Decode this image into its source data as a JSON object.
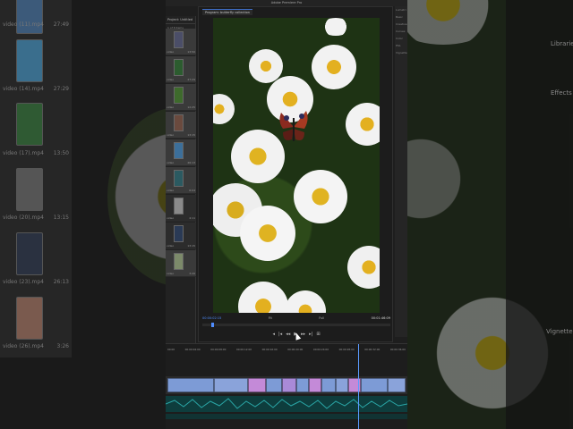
{
  "window": {
    "title": "Adobe Premiere Pro"
  },
  "background_left": {
    "items": [
      {
        "name": "video (11).mp4",
        "duration": "27:49"
      },
      {
        "name": "video (14).mp4",
        "duration": "27:29"
      },
      {
        "name": "video (17).mp4",
        "duration": "13:50"
      },
      {
        "name": "video (20).mp4",
        "duration": "13:15"
      },
      {
        "name": "video (23).mp4",
        "duration": "26:13"
      },
      {
        "name": "video (26).mp4",
        "duration": "3:26"
      }
    ]
  },
  "background_right": {
    "labels": [
      "Libraries",
      "Effects",
      "Vignette"
    ]
  },
  "project": {
    "tab": "Project: Untitled",
    "header": "1 of 8 items selected",
    "clips": [
      {
        "name": "video",
        "dur": "13:50"
      },
      {
        "name": "video",
        "dur": "27:29"
      },
      {
        "name": "video",
        "dur": "12:25"
      },
      {
        "name": "video",
        "dur": "13:15"
      },
      {
        "name": "video",
        "dur": "26:13"
      },
      {
        "name": "video",
        "dur": "6:04"
      },
      {
        "name": "video",
        "dur": "4:11"
      },
      {
        "name": "video",
        "dur": "13:15"
      },
      {
        "name": "video",
        "dur": "3:26"
      }
    ]
  },
  "monitor": {
    "tab": "Program: butterfly collection",
    "timecode_left": "00:00:02:15",
    "timecode_mid": "Fit",
    "zoom": "Full",
    "timecode_right": "00:01:46:09"
  },
  "controls": [
    "◂",
    "|◂",
    "◂◂",
    "▶",
    "▸▸",
    "▸|",
    "⊞"
  ],
  "left_controls": [
    "▣",
    "⊟",
    "⊠"
  ],
  "rightpanel": [
    "Lumetri",
    "Basic",
    "Creative",
    "Curves",
    "Color",
    "HSL",
    "Vignette"
  ],
  "timeline": {
    "ruler": [
      "00:00",
      "00:00:04:00",
      "00:00:08:00",
      "00:00:12:00",
      "00:00:16:00",
      "00:00:20:00",
      "00:00:24:00",
      "00:00:28:00",
      "00:00:32:00",
      "00:00:36:00"
    ]
  },
  "colors": {
    "accent": "#4f8dff",
    "clip_blue": "#7d9bd6",
    "clip_pink": "#c48ad8",
    "audio": "#0e3d3d"
  }
}
